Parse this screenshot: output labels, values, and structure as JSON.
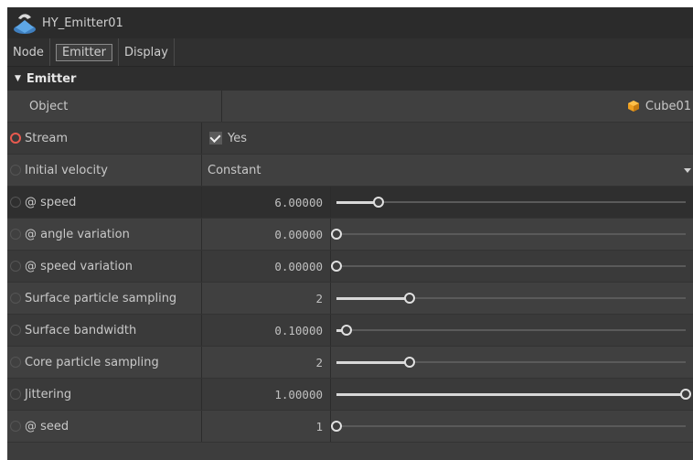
{
  "node": {
    "title": "HY_Emitter01"
  },
  "tabs": [
    {
      "label": "Node"
    },
    {
      "label": "Emitter",
      "active": true
    },
    {
      "label": "Display"
    }
  ],
  "section": {
    "label": "Emitter",
    "expanded": true
  },
  "rows": {
    "object": {
      "label": "Object",
      "value": "Cube01",
      "icon": "cube-icon"
    },
    "stream": {
      "label": "Stream",
      "value": "Yes",
      "checked": true,
      "animated": true
    },
    "initial_velocity": {
      "label": "Initial velocity",
      "value": "Constant"
    },
    "speed": {
      "label": "@ speed",
      "value": "6.00000",
      "fill": 0.12
    },
    "angle_variation": {
      "label": "@ angle variation",
      "value": "0.00000",
      "fill": 0.0
    },
    "speed_variation": {
      "label": "@ speed variation",
      "value": "0.00000",
      "fill": 0.0
    },
    "surface_particle_sampling": {
      "label": "Surface particle sampling",
      "value": "2",
      "fill": 0.21
    },
    "surface_bandwidth": {
      "label": "Surface bandwidth",
      "value": "0.10000",
      "fill": 0.03
    },
    "core_particle_sampling": {
      "label": "Core particle sampling",
      "value": "2",
      "fill": 0.21
    },
    "jittering": {
      "label": "Jittering",
      "value": "1.00000",
      "fill": 1.0
    },
    "seed": {
      "label": "@ seed",
      "value": "1",
      "fill": 0.0
    }
  },
  "colors": {
    "panel_bg": "#3d3d3d",
    "active_dot": "#e85a4f",
    "cube": "#f0a020"
  }
}
